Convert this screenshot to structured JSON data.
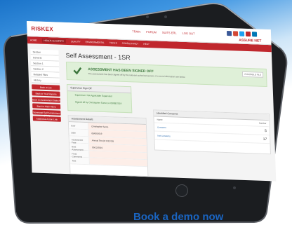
{
  "header": {
    "logo": "RISKEX",
    "links": [
      "TRAIN",
      "FORUM",
      "SUITS ERL",
      "LOG OUT"
    ],
    "brand_badge": "ASSURE NET",
    "social_colors": [
      "#3b5998",
      "#d34836",
      "#1da1f2",
      "#c0272d",
      "#0077b5"
    ]
  },
  "nav": {
    "items": [
      "HOME",
      "HEALTH & SAFETY",
      "QUALITY",
      "ENVIRONMENTAL",
      "TOOLS",
      "CONSULTANCY",
      "HELP"
    ],
    "active_index": 1
  },
  "sidebar": {
    "items": [
      "Section",
      "General",
      "Section 1",
      "Section 2",
      "Related Files",
      "History"
    ],
    "buttons": [
      "Back to List",
      "Back to Your Reports",
      "Back to Assessment Search",
      "Back to Main Menu",
      "Download Self Assessment (PDF)",
      "Additional Action Link"
    ]
  },
  "main": {
    "title": "Self Assessment - 1SR",
    "signed_title": "ASSESSMENT HAS BEEN SIGNED OFF",
    "signed_sub": "The assessment has been signed off by the relevant authorised person. For more information see below.",
    "signed_tag": "PRINTABLE FILE",
    "supervisor_head": "Supervisor Sign Off",
    "supervisor_line1": "Supervisor: Not Applicable Supervisor",
    "supervisor_line2": "Signed off by Christopher Sumo on 09/08/2019",
    "details_head": "Assessment Details",
    "details_rows": [
      {
        "label": "User",
        "value": "Christopher Sumo"
      },
      {
        "label": "Date",
        "value": "09/08/2019"
      },
      {
        "label": "Assessment Type",
        "value": "Annual Test (R 0/12/19)"
      },
      {
        "label": "Next Assessment Date",
        "value": "09/12/2019"
      },
      {
        "label": "Final Comments",
        "value": ""
      },
      {
        "label": "Text",
        "value": ""
      }
    ],
    "hazards_head": "Identified Concerns",
    "hazards_cols": [
      "Name",
      "Number"
    ],
    "hazards_rows": [
      {
        "name": "Concerns",
        "count": "5"
      },
      {
        "name": "Not Concerns",
        "count": "17"
      }
    ]
  },
  "cta": "Book a demo now"
}
